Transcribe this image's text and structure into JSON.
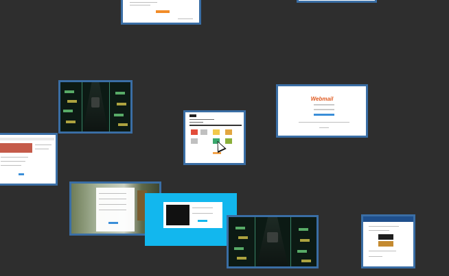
{
  "desktop": {
    "background": "#2e2e2e",
    "accent": "#3a6ea5"
  },
  "windows": {
    "webmail": {
      "logo_text": "Webmail"
    }
  },
  "icons": {
    "pointer": "mouse-pointer-icon"
  }
}
